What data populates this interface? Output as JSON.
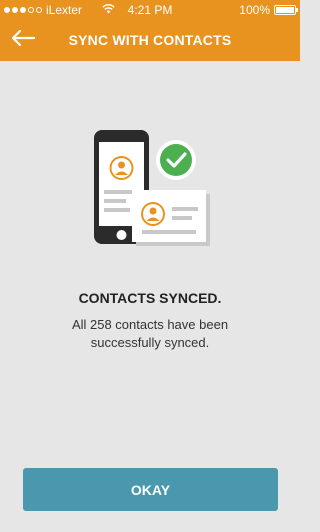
{
  "status_bar": {
    "carrier": "iLexter",
    "time": "4:21 PM",
    "battery": "100%",
    "battery_level": 1.0
  },
  "nav": {
    "back_icon": "arrow-left-icon",
    "title": "SYNC WITH CONTACTS"
  },
  "illustration": {
    "icons": [
      "phone-icon",
      "contact-card-icon",
      "checkmark-icon"
    ]
  },
  "content": {
    "heading": "CONTACTS SYNCED.",
    "message": "All 258 contacts have been successfully synced."
  },
  "actions": {
    "okay_label": "OKAY"
  },
  "colors": {
    "header": "#e8921f",
    "background": "#e6e6e6",
    "button": "#4a98ad",
    "check": "#4caf50",
    "avatar": "#e8921f"
  }
}
